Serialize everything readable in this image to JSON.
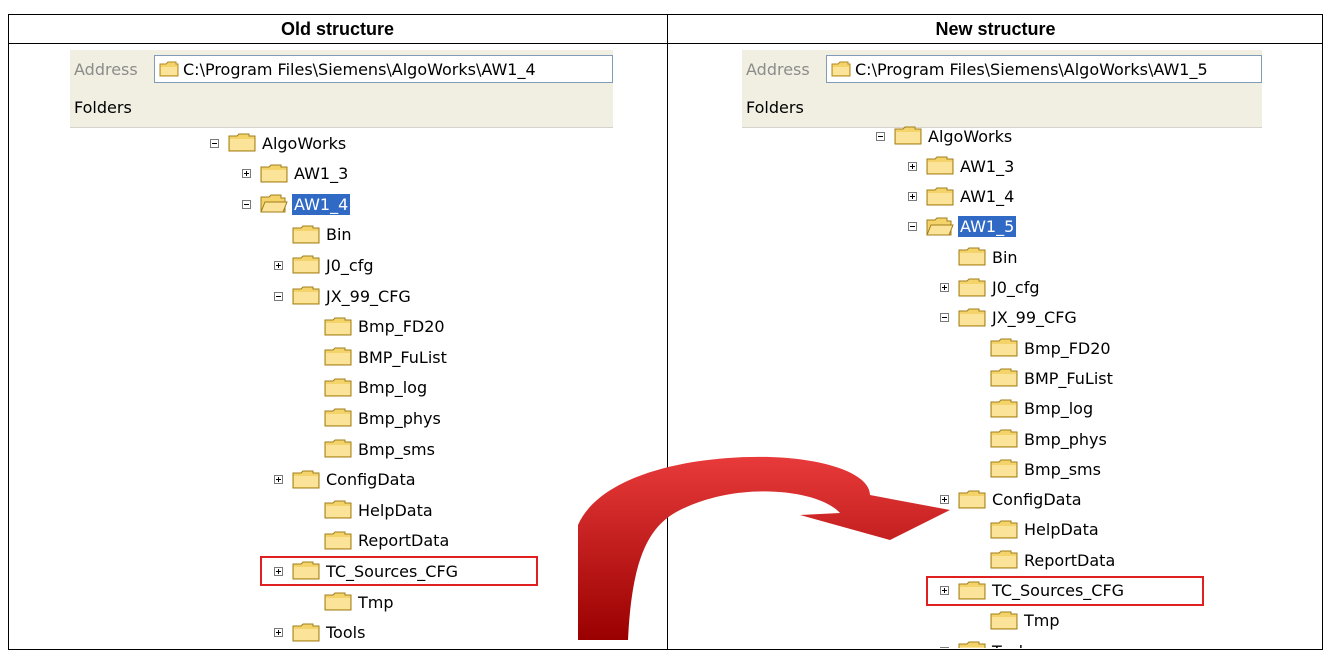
{
  "columns": {
    "left_title": "Old structure",
    "right_title": "New structure"
  },
  "left": {
    "address_label": "Address",
    "address_path": "C:\\Program Files\\Siemens\\AlgoWorks\\AW1_4",
    "folders_label": "Folders",
    "tree": [
      {
        "label": "AlgoWorks",
        "expander": "minus"
      },
      {
        "label": "AW1_3",
        "expander": "plus"
      },
      {
        "label": "AW1_4",
        "expander": "minus",
        "selected": true
      },
      {
        "label": "Bin",
        "expander": "none"
      },
      {
        "label": "J0_cfg",
        "expander": "plus"
      },
      {
        "label": "JX_99_CFG",
        "expander": "minus"
      },
      {
        "label": "Bmp_FD20",
        "expander": "none"
      },
      {
        "label": "BMP_FuList",
        "expander": "none"
      },
      {
        "label": "Bmp_log",
        "expander": "none"
      },
      {
        "label": "Bmp_phys",
        "expander": "none"
      },
      {
        "label": "Bmp_sms",
        "expander": "none"
      },
      {
        "label": "ConfigData",
        "expander": "plus"
      },
      {
        "label": "HelpData",
        "expander": "none"
      },
      {
        "label": "ReportData",
        "expander": "none"
      },
      {
        "label": "TC_Sources_CFG",
        "expander": "plus",
        "highlighted": true
      },
      {
        "label": "Tmp",
        "expander": "none"
      },
      {
        "label": "Tools",
        "expander": "plus"
      }
    ]
  },
  "right": {
    "address_label": "Address",
    "address_path": "C:\\Program Files\\Siemens\\AlgoWorks\\AW1_5",
    "folders_label": "Folders",
    "tree": [
      {
        "label": "AlgoWorks",
        "expander": "minus"
      },
      {
        "label": "AW1_3",
        "expander": "plus"
      },
      {
        "label": "AW1_4",
        "expander": "plus"
      },
      {
        "label": "AW1_5",
        "expander": "minus",
        "selected": true
      },
      {
        "label": "Bin",
        "expander": "none"
      },
      {
        "label": "J0_cfg",
        "expander": "plus"
      },
      {
        "label": "JX_99_CFG",
        "expander": "minus"
      },
      {
        "label": "Bmp_FD20",
        "expander": "none"
      },
      {
        "label": "BMP_FuList",
        "expander": "none"
      },
      {
        "label": "Bmp_log",
        "expander": "none"
      },
      {
        "label": "Bmp_phys",
        "expander": "none"
      },
      {
        "label": "Bmp_sms",
        "expander": "none"
      },
      {
        "label": "ConfigData",
        "expander": "plus"
      },
      {
        "label": "HelpData",
        "expander": "none"
      },
      {
        "label": "ReportData",
        "expander": "none"
      },
      {
        "label": "TC_Sources_CFG",
        "expander": "plus",
        "highlighted": true
      },
      {
        "label": "Tmp",
        "expander": "none"
      },
      {
        "label": "Tools",
        "expander": "plus"
      }
    ]
  },
  "colors": {
    "selection": "#316ac5",
    "highlight_box": "#e02020",
    "arrow": "#cc0000",
    "folder": "#f5d36b"
  }
}
